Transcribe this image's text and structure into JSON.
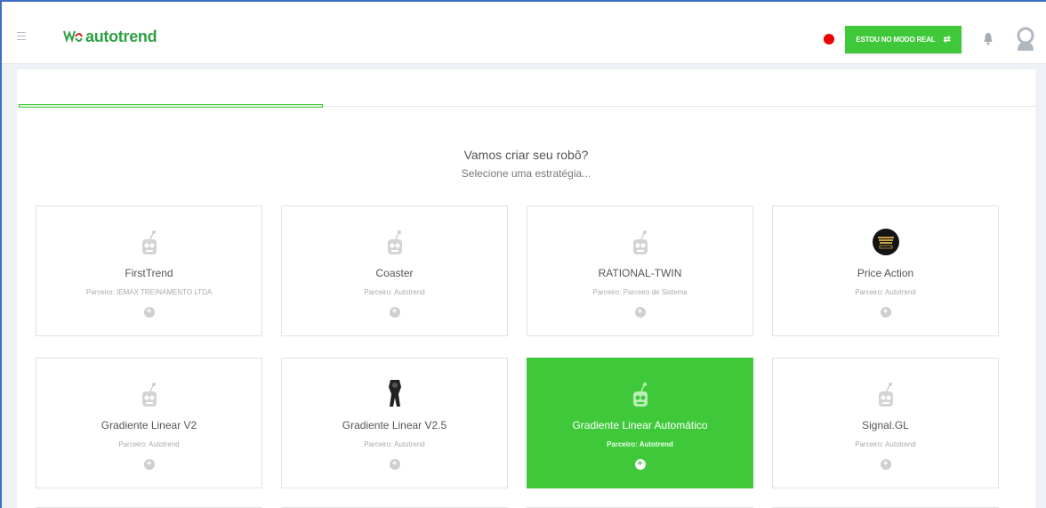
{
  "header": {
    "logo_text_a": "autotrend",
    "mode_button_label": "ESTOU NO MODO REAL",
    "mode_button_icon": "swap-icon",
    "live_indicator_color": "#ef0000",
    "accent_color": "#3ec83a"
  },
  "main": {
    "heading": "Vamos criar seu robô?",
    "subheading": "Selecione uma estratégia...",
    "strategies": [
      {
        "name": "FirstTrend",
        "partner": "Parceiro: IEMAX TREINAMENTO LTDA",
        "icon": "robot-icon"
      },
      {
        "name": "Coaster",
        "partner": "Parceiro: Autotrend",
        "icon": "robot-icon"
      },
      {
        "name": "RATIONAL-TWIN",
        "partner": "Parceiro: Parceiro de Sistema",
        "icon": "robot-icon"
      },
      {
        "name": "Price Action",
        "partner": "Parceiro: Autotrend",
        "icon": "price-action-logo"
      },
      {
        "name": "Gradiente Linear V2",
        "partner": "Parceiro: Autotrend",
        "icon": "robot-icon"
      },
      {
        "name": "Gradiente Linear V2.5",
        "partner": "Parceiro: Autotrend",
        "icon": "figure-icon"
      },
      {
        "name": "Gradiente Linear Automático",
        "partner": "Parceiro: Autotrend",
        "icon": "robot-icon",
        "selected": true
      },
      {
        "name": "Signal.GL",
        "partner": "Parceiro: Autotrend",
        "icon": "robot-icon"
      }
    ],
    "add_icon_glyph": "+"
  }
}
